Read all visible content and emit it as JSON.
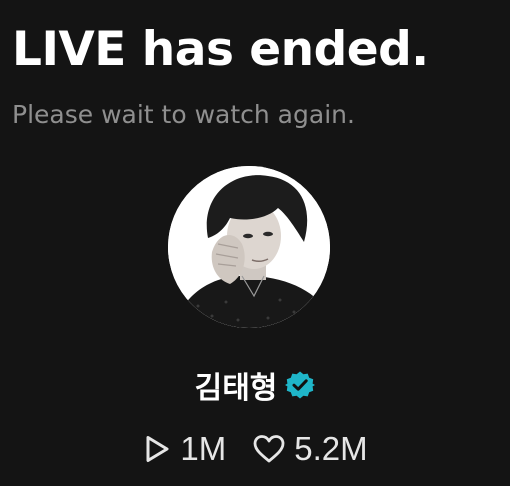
{
  "live_status": {
    "title": "LIVE has ended.",
    "subtitle": "Please wait to watch again."
  },
  "profile": {
    "name": "김태형",
    "verified": true,
    "avatar_icon": "profile-photo",
    "verified_icon": "verified-badge-icon",
    "verified_color": "#1fb6c9"
  },
  "stats": {
    "plays": {
      "icon": "play-icon",
      "value": "1M"
    },
    "likes": {
      "icon": "heart-icon",
      "value": "5.2M"
    }
  },
  "colors": {
    "background": "#141414",
    "title": "#ffffff",
    "subtitle": "#8f8f8f",
    "stats_text": "#e6e6e6"
  }
}
